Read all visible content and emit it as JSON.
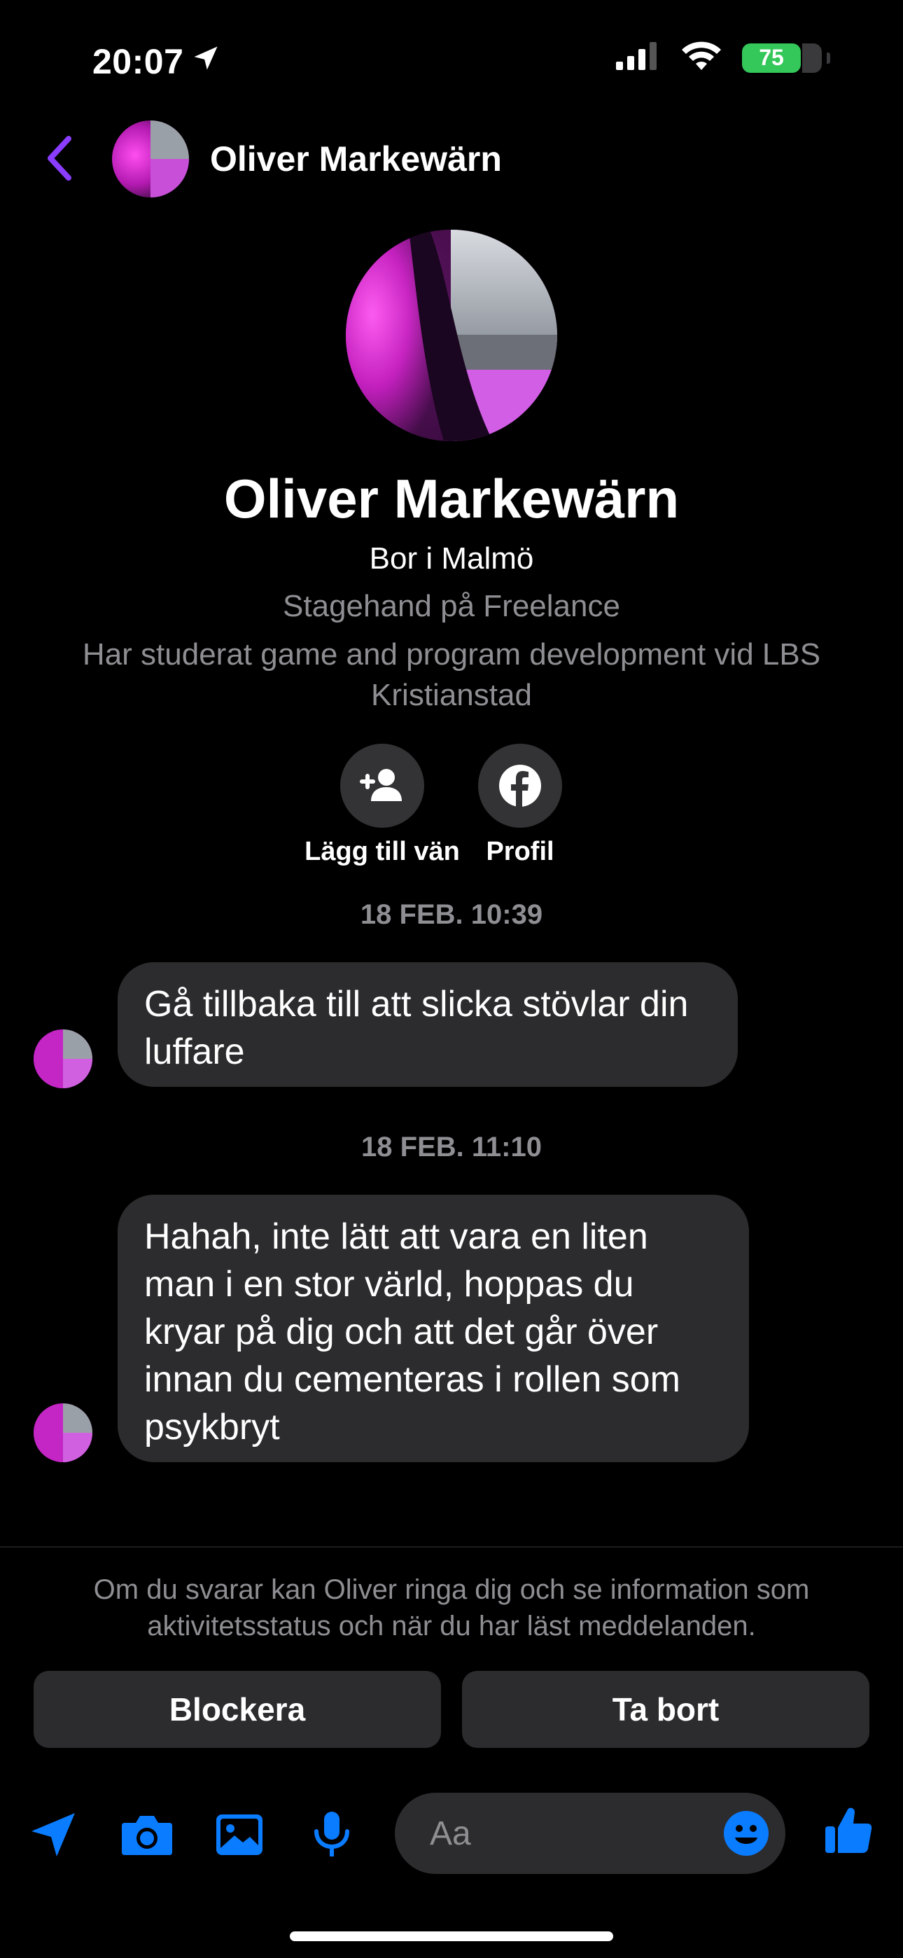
{
  "status_bar": {
    "time": "20:07",
    "battery": "75"
  },
  "header": {
    "contact_name": "Oliver Markewärn"
  },
  "profile": {
    "name": "Oliver Markewärn",
    "location": "Bor i Malmö",
    "work": "Stagehand på Freelance",
    "education": "Har studerat game and program development vid LBS Kristianstad",
    "actions": [
      {
        "label": "Lägg till vän",
        "icon": "add-friend-icon"
      },
      {
        "label": "Profil",
        "icon": "facebook-icon"
      }
    ]
  },
  "messages": [
    {
      "timestamp": "18 FEB. 10:39",
      "text": "Gå tillbaka till att slicka stövlar din luffare"
    },
    {
      "timestamp": "18 FEB. 11:10",
      "text": "Hahah, inte lätt att vara en liten man i en stor värld, hoppas du kryar på dig och att det går över innan du cementeras i rollen som psykbryt"
    }
  ],
  "request": {
    "notice": "Om du svarar kan Oliver ringa dig och se information som aktivitetsstatus och när du har läst meddelanden.",
    "block_label": "Blockera",
    "delete_label": "Ta bort"
  },
  "composer": {
    "placeholder": "Aa",
    "icons": [
      "send-location-icon",
      "camera-icon",
      "gallery-icon",
      "microphone-icon",
      "emoji-icon",
      "thumbs-up-icon"
    ]
  },
  "colors": {
    "accent_purple": "#8b3dff",
    "accent_blue": "#0a7cff",
    "bubble": "#2c2c2e",
    "secondary_text": "#8e8e93",
    "battery_green": "#34c759"
  }
}
